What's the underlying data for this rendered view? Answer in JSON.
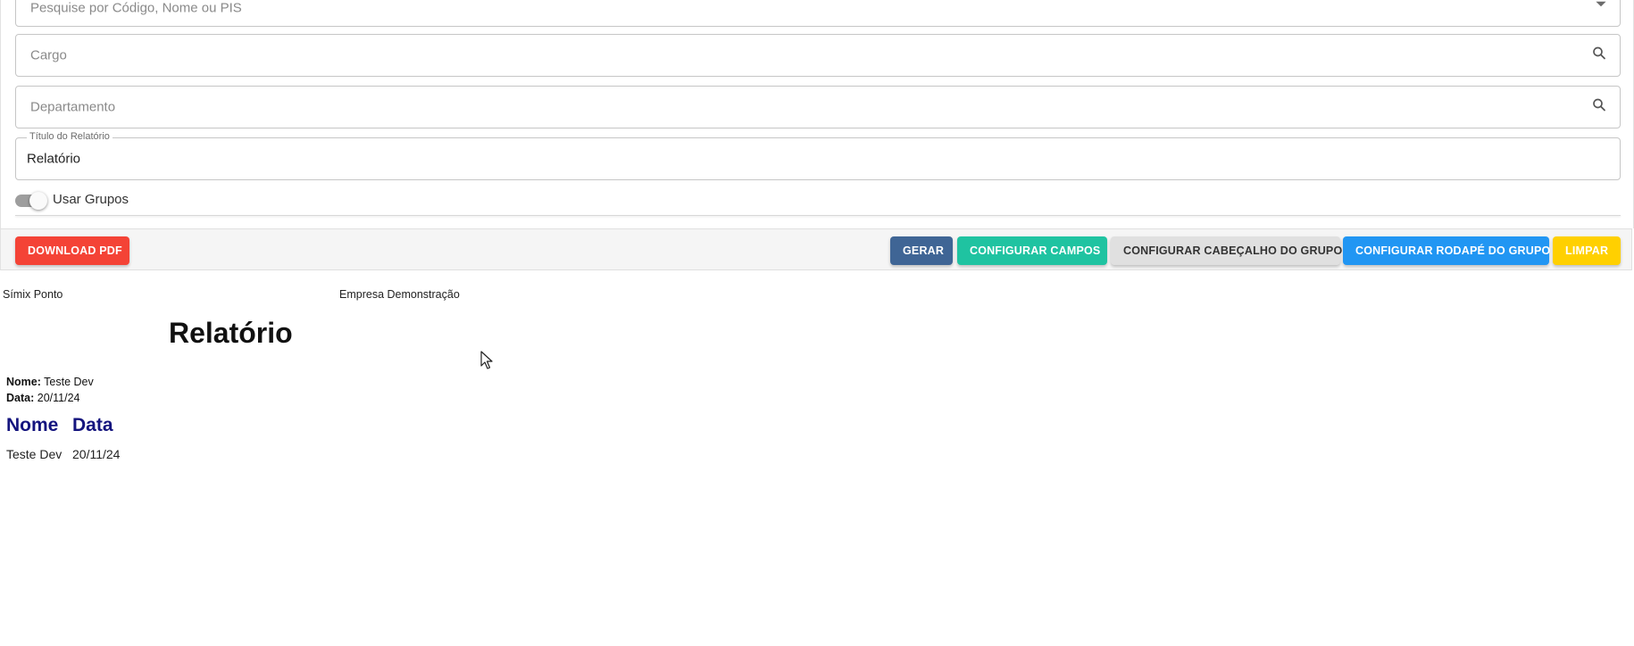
{
  "form": {
    "employee_search": {
      "placeholder": "Pesquise por Código, Nome ou PIS"
    },
    "cargo": {
      "placeholder": "Cargo"
    },
    "departamento": {
      "placeholder": "Departamento"
    },
    "report_title": {
      "label": "Título do Relatório",
      "value": "Relatório"
    },
    "use_groups": {
      "label": "Usar Grupos",
      "checked": false
    }
  },
  "toolbar": {
    "download_pdf": "DOWNLOAD PDF",
    "gerar": "GERAR",
    "configurar_campos": "CONFIGURAR CAMPOS",
    "configurar_cabecalho": "CONFIGURAR CABEÇALHO DO GRUPO",
    "configurar_rodape": "CONFIGURAR RODAPÉ DO GRUPO",
    "limpar": "LIMPAR"
  },
  "colors": {
    "danger": "#f44336",
    "primary_dark": "#3f6595",
    "teal": "#1fc3a1",
    "info": "#2196f3",
    "warning": "#ffd000",
    "header_text": "#14147e"
  },
  "report": {
    "app_name": "Símix Ponto",
    "company": "Empresa Demonstração",
    "title": "Relatório",
    "group_header": {
      "nome_label": "Nome:",
      "nome_value": "Teste Dev",
      "data_label": "Data:",
      "data_value": "20/11/24"
    },
    "columns": [
      "Nome",
      "Data"
    ],
    "rows": [
      [
        "Teste Dev",
        "20/11/24"
      ]
    ]
  }
}
